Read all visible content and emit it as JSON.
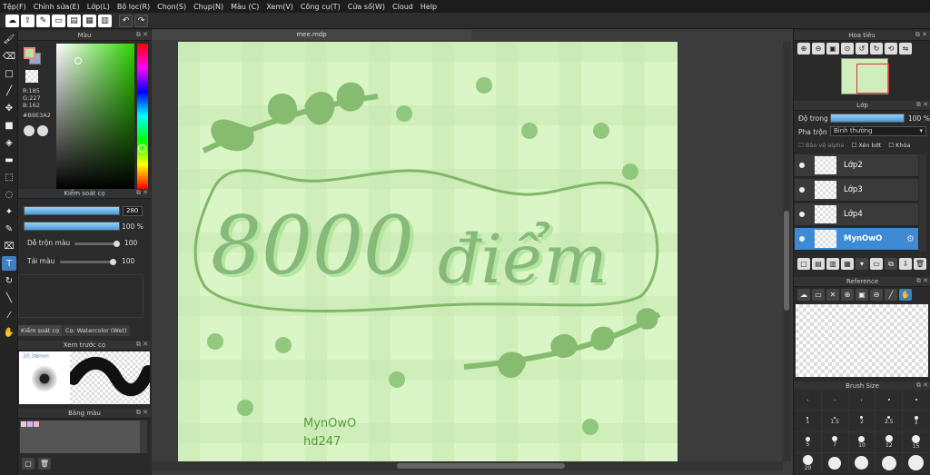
{
  "menu": [
    "Tệp(F)",
    "Chỉnh sửa(E)",
    "Lớp(L)",
    "Bộ lọc(R)",
    "Chọn(S)",
    "Chụp(N)",
    "Màu (C)",
    "Xem(V)",
    "Công cụ(T)",
    "Cửa sổ(W)",
    "Cloud",
    "Help"
  ],
  "document": {
    "title": "mee.mdp"
  },
  "color_panel": {
    "title": "Màu",
    "r": "R:185",
    "g": "G:227",
    "b": "B:162",
    "hex": "#B9E3A2",
    "foreground": "#B9E3A2"
  },
  "brush_control": {
    "title": "Kiểm soát cọ",
    "size": "280",
    "opacity": "100 %",
    "blend_label": "Dễ trộn màu",
    "blend_value": "100",
    "load_label": "Tải màu",
    "load_value": "100",
    "tab1": "Kiểm soát cọ",
    "tab2": "Cọ: Watercolor (Wet)"
  },
  "preview": {
    "title": "Xem trước cọ",
    "size": "20.38mm"
  },
  "palette": {
    "title": "Bảng màu"
  },
  "artwork": {
    "main_text": "8000 điểm",
    "signature_line1": "MynOwO",
    "signature_line2": "hd247"
  },
  "navigator": {
    "title": "Hoa tiêu"
  },
  "layers": {
    "title": "Lớp",
    "opacity_label": "Độ trong",
    "opacity_value": "100 %",
    "blend_label": "Pha trộn",
    "blend_value": "Bình thường",
    "protect_alpha": "Bảo vệ alpha",
    "clipping": "Xén bớt",
    "lock": "Khóa",
    "items": [
      {
        "name": "Lớp2",
        "selected": false
      },
      {
        "name": "Lớp3",
        "selected": false
      },
      {
        "name": "Lớp4",
        "selected": false
      },
      {
        "name": "MynOwO",
        "selected": true
      }
    ]
  },
  "reference": {
    "title": "Reference"
  },
  "brush_size": {
    "title": "Brush Size",
    "labels": [
      "1",
      "1.5",
      "2",
      "2.5",
      "3",
      "5",
      "7",
      "10",
      "12",
      "15",
      "20"
    ]
  }
}
